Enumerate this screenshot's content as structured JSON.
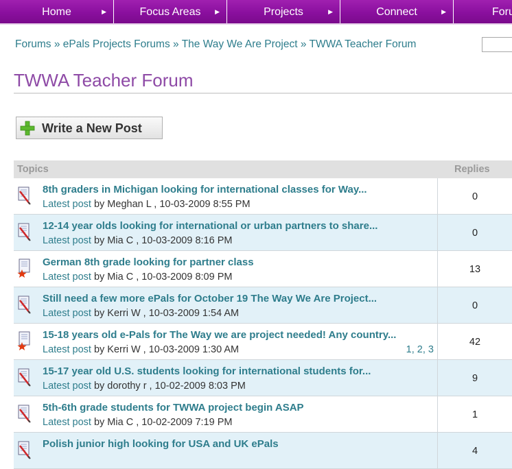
{
  "nav": [
    {
      "label": "Home"
    },
    {
      "label": "Focus Areas"
    },
    {
      "label": "Projects"
    },
    {
      "label": "Connect"
    },
    {
      "label": "Foru"
    }
  ],
  "breadcrumb": {
    "items": [
      "Forums",
      "ePals Projects Forums",
      "The Way We Are Project",
      "TWWA Teacher Forum"
    ],
    "separator": "»"
  },
  "page_title": "TWWA Teacher Forum",
  "write_button": {
    "label": "Write a New Post",
    "icon": "plus-icon"
  },
  "table": {
    "col_topics": "Topics",
    "col_replies": "Replies",
    "latest_label": "Latest post",
    "rows": [
      {
        "topic": "8th graders in Michigan looking for international classes for Way...",
        "by": " by Meghan L , 10-03-2009 8:55 PM",
        "replies": "0",
        "icon": "document-pencil-icon"
      },
      {
        "topic": "12-14 year olds looking for international or urban partners to share...",
        "by": " by Mia C , 10-03-2009 8:16 PM",
        "replies": "0",
        "icon": "document-pencil-icon"
      },
      {
        "topic": "German 8th grade looking for partner class",
        "by": " by Mia C , 10-03-2009 8:09 PM",
        "replies": "13",
        "icon": "document-star-icon"
      },
      {
        "topic": "Still need a few more ePals for October 19 The Way We Are Project...",
        "by": " by Kerri W , 10-03-2009 1:54 AM",
        "replies": "0",
        "icon": "document-pencil-icon"
      },
      {
        "topic": "15-18 years old e-Pals for The Way we are project needed! Any country...",
        "by": " by Kerri W , 10-03-2009 1:30 AM",
        "replies": "42",
        "icon": "document-star-icon",
        "pages": [
          "1",
          "2",
          "3"
        ]
      },
      {
        "topic": "15-17 year old U.S. students looking for international students for...",
        "by": " by dorothy r , 10-02-2009 8:03 PM",
        "replies": "9",
        "icon": "document-pencil-icon"
      },
      {
        "topic": "5th-6th grade students for TWWA project begin ASAP",
        "by": " by Mia C , 10-02-2009 7:19 PM",
        "replies": "1",
        "icon": "document-pencil-icon"
      },
      {
        "topic": "Polish junior high looking for USA and UK ePals",
        "by": "",
        "replies": "4",
        "icon": "document-pencil-icon"
      }
    ]
  },
  "colors": {
    "nav": "#8a0f9e",
    "link": "#2e7d8c",
    "title": "#8e4aa6",
    "row_alt": "#e2f1f8"
  }
}
